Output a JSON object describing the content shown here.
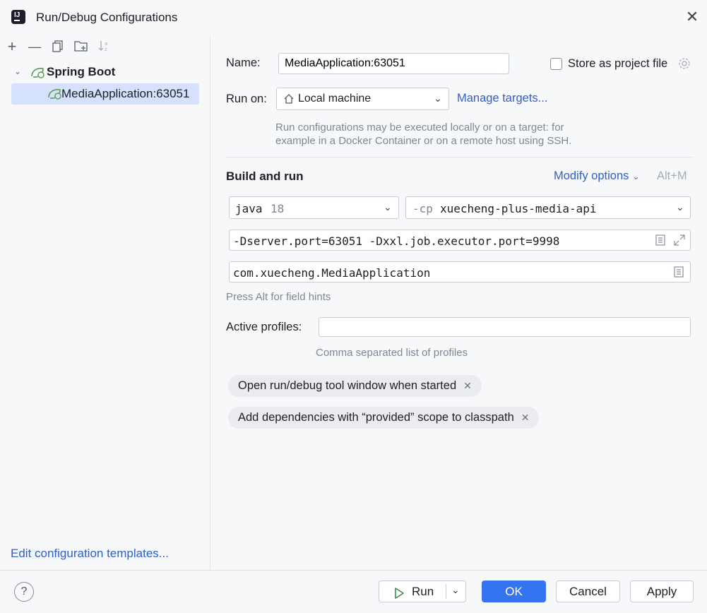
{
  "window": {
    "title": "Run/Debug Configurations"
  },
  "tree": {
    "group_label": "Spring Boot",
    "item_label": "MediaApplication:63051"
  },
  "left_footer": {
    "edit_templates": "Edit configuration templates..."
  },
  "form": {
    "name_label": "Name:",
    "name_value": "MediaApplication:63051",
    "store_label": "Store as project file",
    "run_on_label": "Run on:",
    "run_on_value": "Local machine",
    "manage_targets": "Manage targets...",
    "run_on_hint_1": "Run configurations may be executed locally or on a target: for",
    "run_on_hint_2": "example in a Docker Container or on a remote host using SSH.",
    "build_run_title": "Build and run",
    "modify_options": "Modify options",
    "modify_shortcut": "Alt+M",
    "jre_name": "java",
    "jre_version": "18",
    "cp_prefix": "-cp",
    "cp_value": "xuecheng-plus-media-api",
    "vm_options": "-Dserver.port=63051 -Dxxl.job.executor.port=9998",
    "main_class": "com.xuecheng.MediaApplication",
    "field_hint": "Press Alt for field hints",
    "profiles_label": "Active profiles:",
    "profiles_value": "",
    "profiles_hint": "Comma separated list of profiles",
    "tag_1": "Open run/debug tool window when started",
    "tag_2": "Add dependencies with “provided” scope to classpath"
  },
  "buttons": {
    "help": "?",
    "run": "Run",
    "ok": "OK",
    "cancel": "Cancel",
    "apply": "Apply"
  },
  "colors": {
    "accent": "#3574f0",
    "selection": "#d5e1fd",
    "link": "#2f5fc9"
  }
}
